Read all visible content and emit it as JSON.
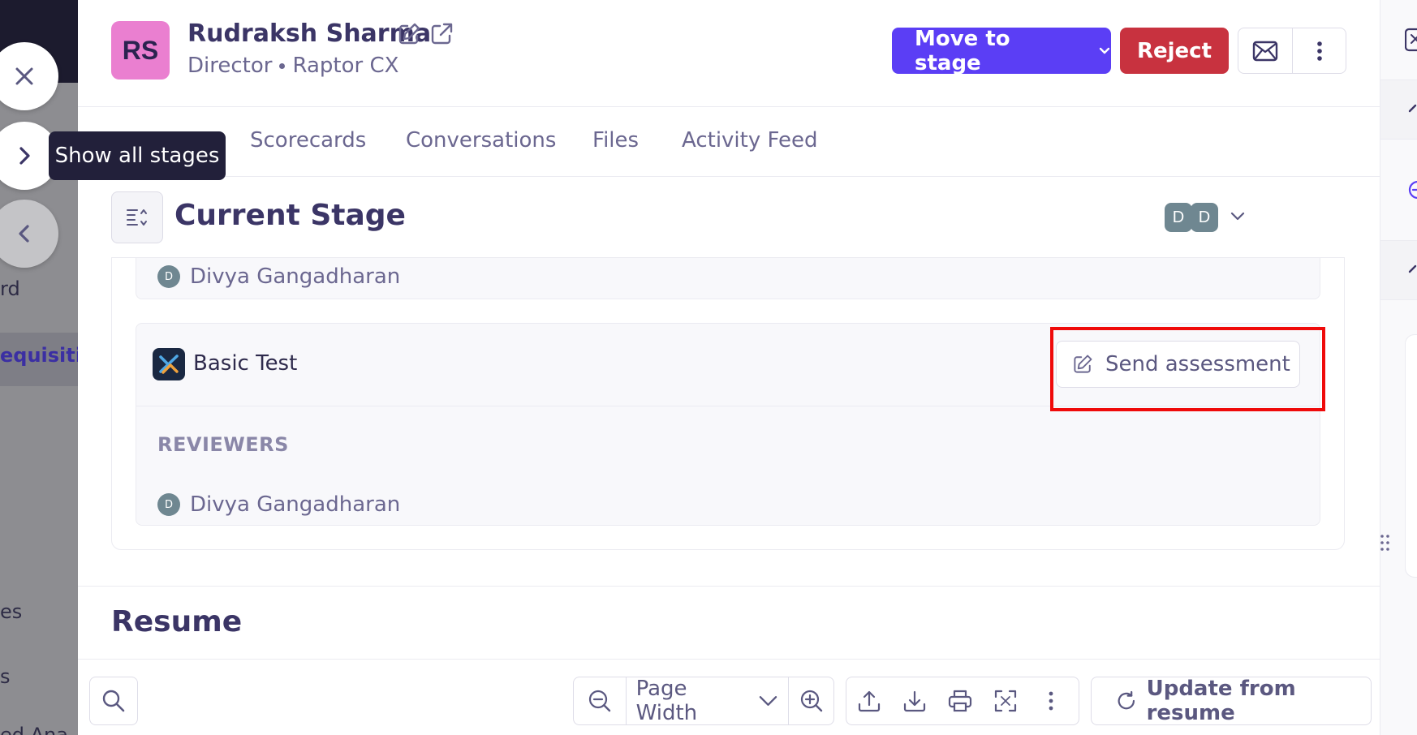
{
  "backdrop": {
    "nav_items": [
      {
        "label": "rd",
        "active": false
      },
      {
        "label": "equisitio",
        "active": true
      },
      {
        "label": "es",
        "active": false
      },
      {
        "label": "s",
        "active": false
      },
      {
        "label": "ed Ana",
        "active": false
      }
    ]
  },
  "stage_controls": {
    "tooltip": "Show all stages"
  },
  "candidate": {
    "initials": "RS",
    "name": "Rudraksh Sharma",
    "title": "Director",
    "company": "Raptor CX",
    "avatar_color": "#ea7fd0"
  },
  "actions": {
    "move_to_stage": "Move to stage",
    "reject": "Reject",
    "primary_color": "#5b3ef5",
    "danger_color": "#c8323f"
  },
  "tabs": [
    {
      "label": "Scorecards"
    },
    {
      "label": "Conversations"
    },
    {
      "label": "Files"
    },
    {
      "label": "Activity Feed"
    }
  ],
  "current_stage": {
    "title": "Current Stage",
    "assignees": [
      "D",
      "D"
    ],
    "first_reviewer": {
      "initial": "D",
      "name": "Divya Gangadharan"
    },
    "test": {
      "name": "Basic Test",
      "action": "Send assessment",
      "reviewers_label": "REVIEWERS",
      "reviewer": {
        "initial": "D",
        "name": "Divya Gangadharan"
      }
    }
  },
  "resume": {
    "title": "Resume",
    "zoom": "Page Width",
    "update_button": "Update from resume"
  },
  "highlight_color": "#ef0a0a"
}
